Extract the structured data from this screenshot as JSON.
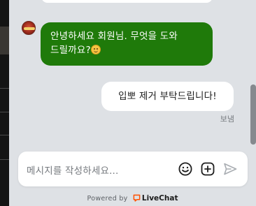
{
  "conversation": {
    "messages": [
      {
        "author": "agent",
        "text_line1": "안녕하세요 회원님. 무엇을 도와",
        "text_line2": "드릴까요?"
      },
      {
        "author": "user",
        "text": "입뽀 제거 부탁드립니다!",
        "status": "보냄"
      }
    ]
  },
  "composer": {
    "placeholder": "메시지를 작성하세요...",
    "emoji_icon": "smiley-icon",
    "attach_icon": "plus-square-icon",
    "send_icon": "send-arrow-icon"
  },
  "footer": {
    "powered_by": "Powered by",
    "brand": "LiveChat"
  },
  "colors": {
    "agent_bubble": "#1f7a0a",
    "chat_background": "#dee1e5",
    "brand_orange": "#ff5100"
  }
}
